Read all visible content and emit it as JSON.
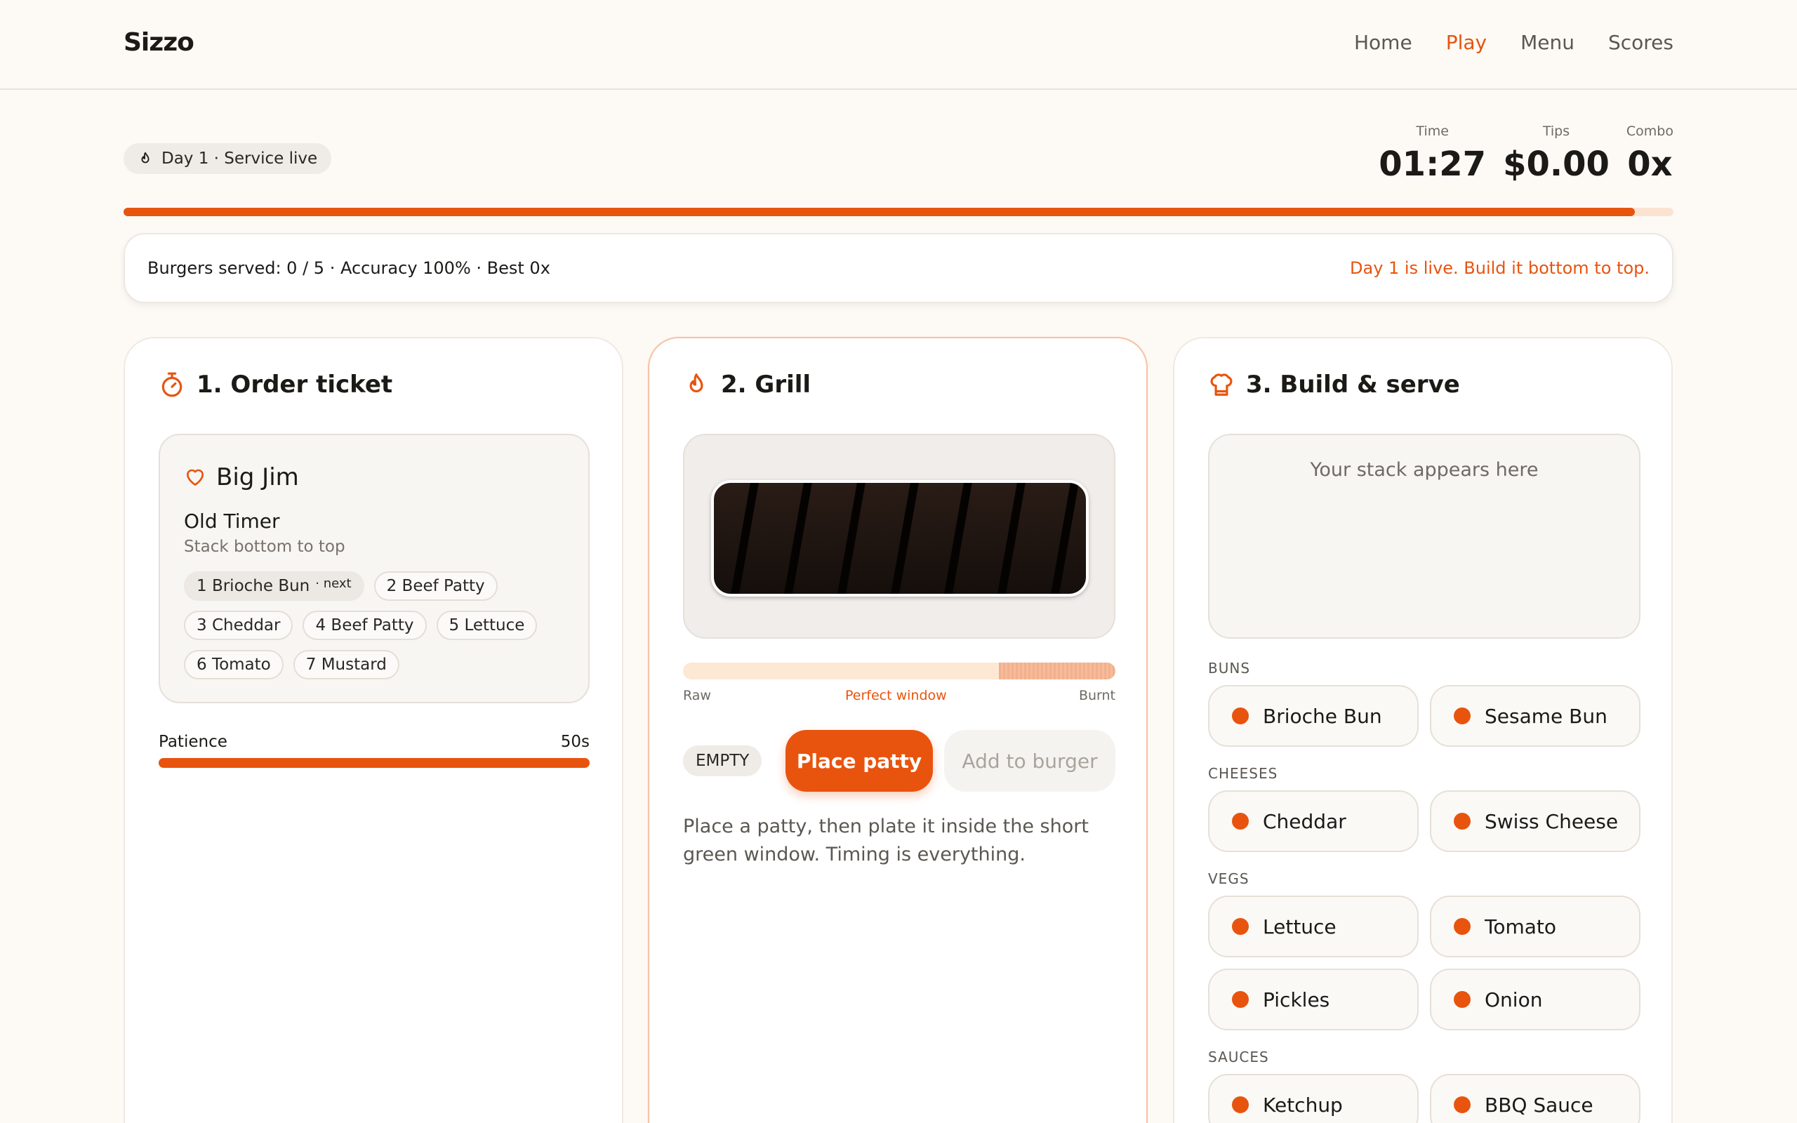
{
  "header": {
    "logo": "Sizzo",
    "nav": [
      {
        "label": "Home",
        "active": false
      },
      {
        "label": "Play",
        "active": true
      },
      {
        "label": "Menu",
        "active": false
      },
      {
        "label": "Scores",
        "active": false
      }
    ]
  },
  "status": {
    "day_label": "Day 1 · Service live",
    "time_label": "Time",
    "time_value": "01:27",
    "tips_label": "Tips",
    "tips_value": "$0.00",
    "combo_label": "Combo",
    "combo_value": "0x",
    "progress_fraction": 0.975
  },
  "banner": {
    "summary": "Burgers served: 0 / 5 · Accuracy 100% · Best 0x",
    "message": "Day 1 is live. Build it bottom to top."
  },
  "order": {
    "title": "1. Order ticket",
    "customer": "Big Jim",
    "burger_name": "Old Timer",
    "hint": "Stack bottom to top",
    "next_tag": "· next",
    "items": [
      "1 Brioche Bun",
      "2 Beef Patty",
      "3 Cheddar",
      "4 Beef Patty",
      "5 Lettuce",
      "6 Tomato",
      "7 Mustard"
    ],
    "patience_label": "Patience",
    "patience_value": "50s",
    "patience_fraction": 1.0
  },
  "grill": {
    "title": "2. Grill",
    "raw_label": "Raw",
    "perfect_label": "Perfect window",
    "burnt_label": "Burnt",
    "perfect_window": [
      0.73,
      1.0
    ],
    "state": "EMPTY",
    "place_button": "Place patty",
    "add_button": "Add to burger",
    "help": "Place a patty, then plate it inside the short green window. Timing is everything."
  },
  "build": {
    "title": "3. Build & serve",
    "stack_placeholder": "Your stack appears here",
    "groups": [
      {
        "label": "BUNS",
        "items": [
          "Brioche Bun",
          "Sesame Bun"
        ]
      },
      {
        "label": "CHEESES",
        "items": [
          "Cheddar",
          "Swiss Cheese"
        ]
      },
      {
        "label": "VEGS",
        "items": [
          "Lettuce",
          "Tomato",
          "Pickles",
          "Onion"
        ]
      },
      {
        "label": "SAUCES",
        "items": [
          "Ketchup",
          "BBQ Sauce"
        ]
      }
    ]
  },
  "colors": {
    "accent": "#e8540e",
    "background": "#fdfaf6"
  }
}
